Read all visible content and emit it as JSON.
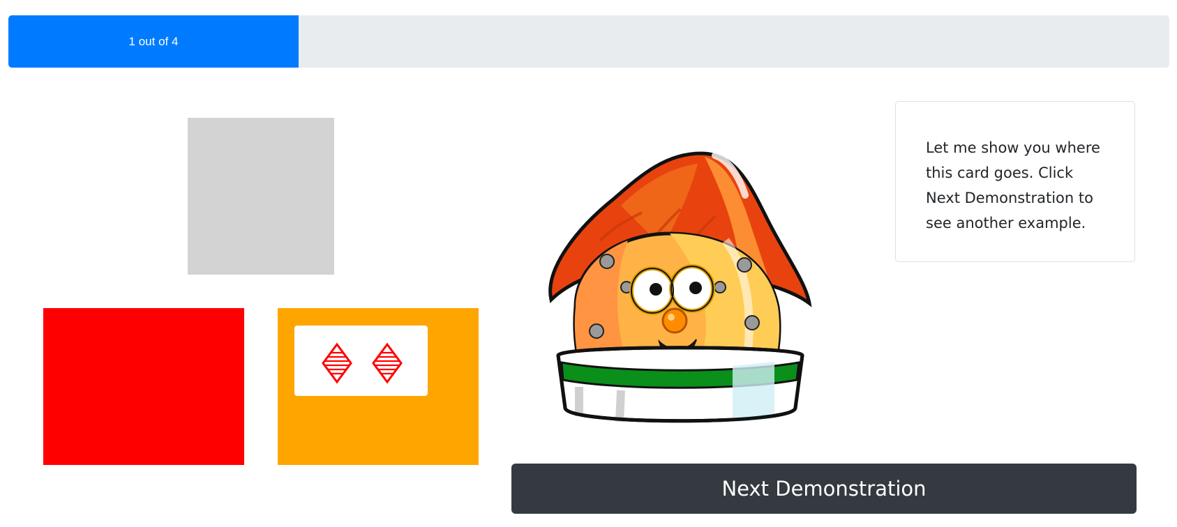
{
  "progress": {
    "label": "1 out of 4",
    "current": 1,
    "total": 4,
    "fraction": 0.25,
    "fill_color": "#007bff"
  },
  "deck": {
    "placeholder_color": "#d3d3d3"
  },
  "cards": [
    {
      "color": "#ff0000",
      "shape": null,
      "count": 0
    },
    {
      "color": "#ffa500",
      "shape": "diamond-icon",
      "shape_color": "#ff0000",
      "count": 2
    }
  ],
  "character": {
    "icon": "robot-character-icon"
  },
  "instruction": {
    "text": "Let me show you where this card goes. Click Next Demonstration to see another example."
  },
  "next_button": {
    "label": "Next Demonstration"
  }
}
